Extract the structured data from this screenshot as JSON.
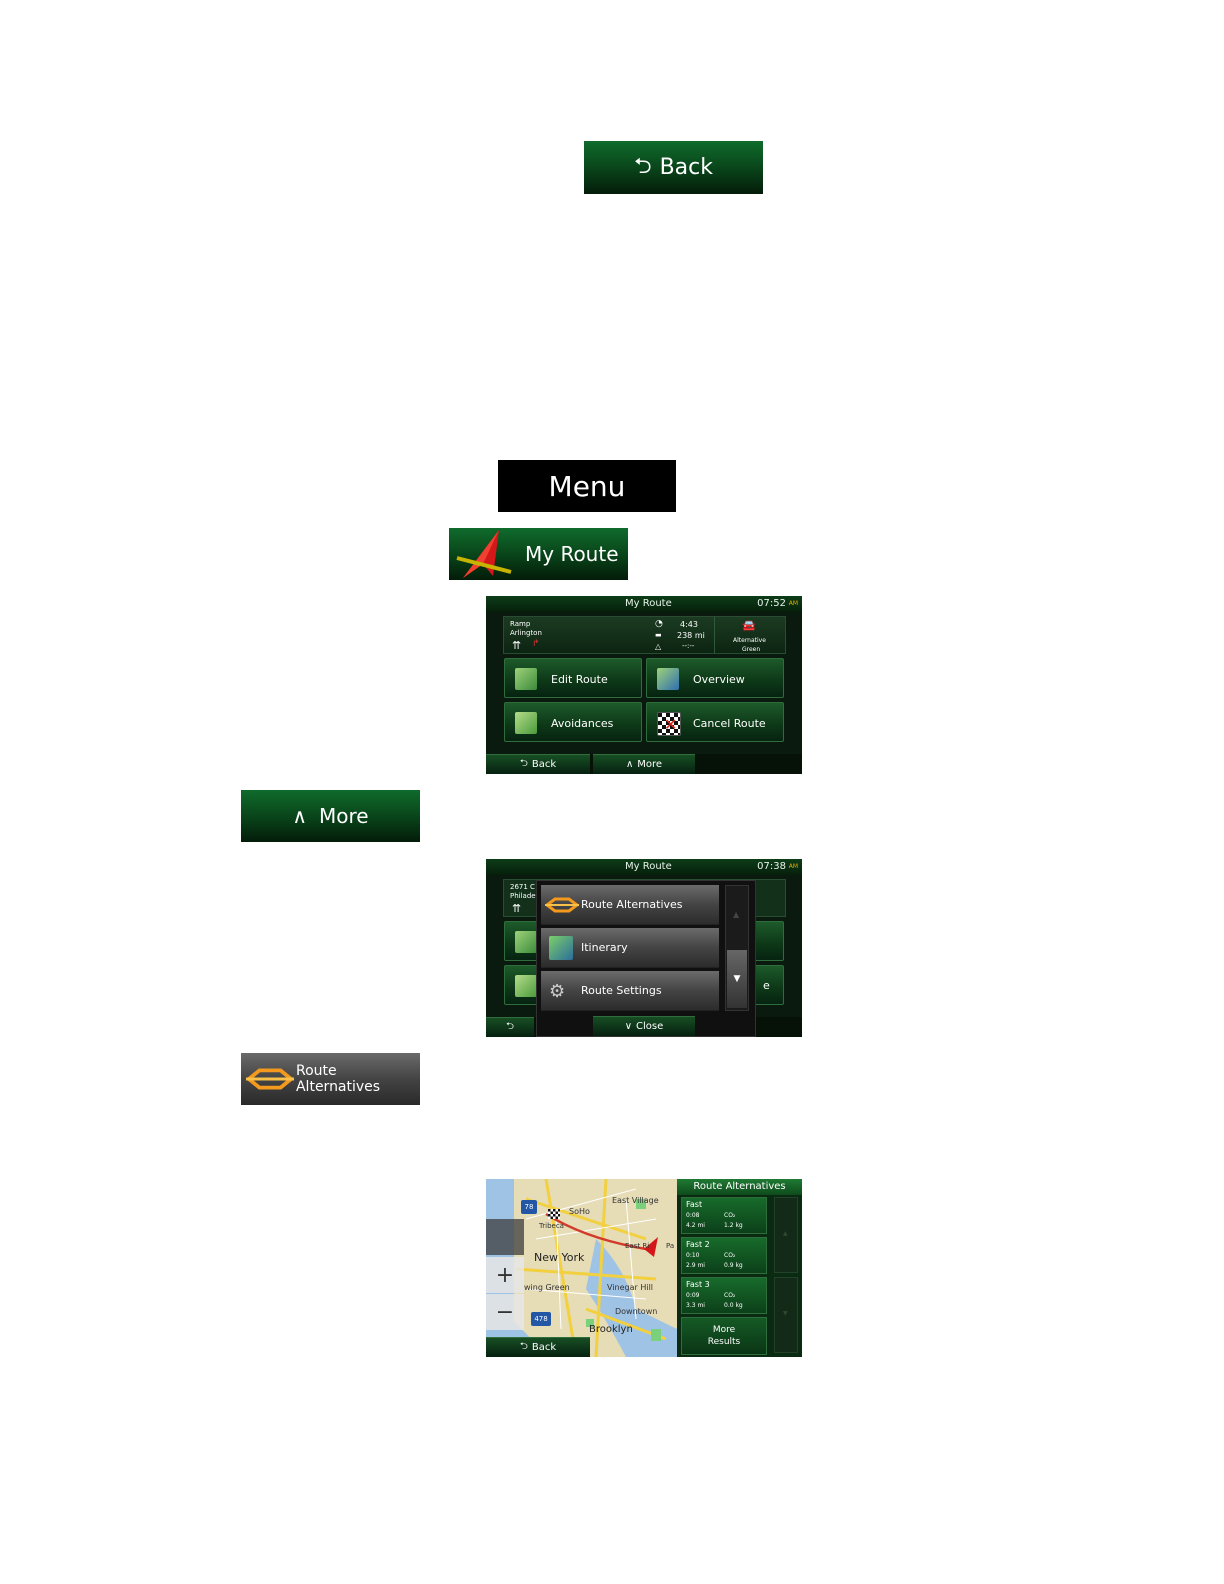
{
  "back_button": {
    "label": "Back"
  },
  "menu_button": {
    "label": "Menu"
  },
  "my_route_button": {
    "label": "My Route"
  },
  "screen1": {
    "title": "My Route",
    "clock": "07:52",
    "ampm": "AM",
    "info": {
      "street_line1": "Ramp",
      "street_line2": "Arlington",
      "time": "4:43",
      "distance": "238 mi",
      "eta": "--:--",
      "alt_line1": "Alternative",
      "alt_line2": "Green"
    },
    "tiles": [
      "Edit Route",
      "Overview",
      "Avoidances",
      "Cancel Route"
    ],
    "back": "Back",
    "more": "More"
  },
  "more_button": {
    "label": "More"
  },
  "screen2": {
    "title": "My Route",
    "clock": "07:38",
    "ampm": "AM",
    "street_line1": "2671 C",
    "street_line2": "Philade",
    "menu_items": [
      "Route Alternatives",
      "Itinerary",
      "Route Settings"
    ],
    "close": "Close",
    "edge_text": "e"
  },
  "route_alternatives_button": {
    "label": "Route Alternatives"
  },
  "screen3": {
    "panel_title": "Route Alternatives",
    "map_labels": [
      "East Village",
      "SoHo",
      "Tribeca",
      "New York",
      "East Ri",
      "Pa",
      "wing Green",
      "Vinegar Hill",
      "Downtown",
      "Brooklyn"
    ],
    "shields": [
      "78",
      "478"
    ],
    "alternatives": [
      {
        "name": "Fast",
        "time": "0:08",
        "dist": "4.2 mi",
        "co2": "CO₂",
        "co2_val": "1.2 kg"
      },
      {
        "name": "Fast 2",
        "time": "0:10",
        "dist": "2.9 mi",
        "co2": "CO₂",
        "co2_val": "0.9 kg"
      },
      {
        "name": "Fast 3",
        "time": "0:09",
        "dist": "3.3 mi",
        "co2": "CO₂",
        "co2_val": "0.0 kg"
      }
    ],
    "more_results_line1": "More",
    "more_results_line2": "Results",
    "zoom_in": "+",
    "zoom_out": "−",
    "back": "Back"
  }
}
